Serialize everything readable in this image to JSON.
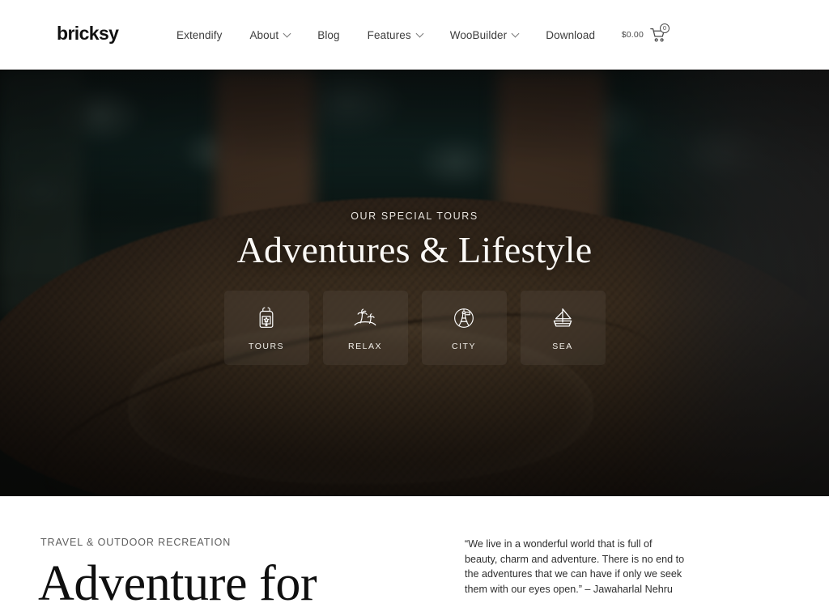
{
  "header": {
    "logo": "bricksy",
    "nav": [
      {
        "label": "Extendify",
        "has_dropdown": false
      },
      {
        "label": "About",
        "has_dropdown": true
      },
      {
        "label": "Blog",
        "has_dropdown": false
      },
      {
        "label": "Features",
        "has_dropdown": true
      },
      {
        "label": "WooBuilder",
        "has_dropdown": true
      },
      {
        "label": "Download",
        "has_dropdown": false
      }
    ],
    "cart": {
      "amount": "$0.00",
      "count": "0",
      "icon": "shopping-cart-icon"
    }
  },
  "hero": {
    "eyebrow": "OUR SPECIAL TOURS",
    "title": "Adventures & Lifestyle",
    "cards": [
      {
        "label": "TOURS",
        "icon": "backpack-icon"
      },
      {
        "label": "RELAX",
        "icon": "palm-tree-island-icon"
      },
      {
        "label": "CITY",
        "icon": "eiffel-tower-icon"
      },
      {
        "label": "SEA",
        "icon": "sailboat-icon"
      }
    ]
  },
  "lower": {
    "eyebrow": "TRAVEL & OUTDOOR RECREATION",
    "title": "Adventure for",
    "quote": "“We live in a wonderful world that is full of beauty, charm and adventure. There is no end to the adventures that we can have if only we seek them with our eyes open.” – Jawaharlal Nehru"
  },
  "colors": {
    "page_background": "#ffffff",
    "header_background": "#ffffff",
    "text_primary": "#111111",
    "nav_text": "#3d3d3d",
    "hero_title": "#fbf9f6",
    "hero_overlay_dark": "#2b2b2b",
    "water_teal": "#102523",
    "straw_brown": "#3d2f20"
  }
}
